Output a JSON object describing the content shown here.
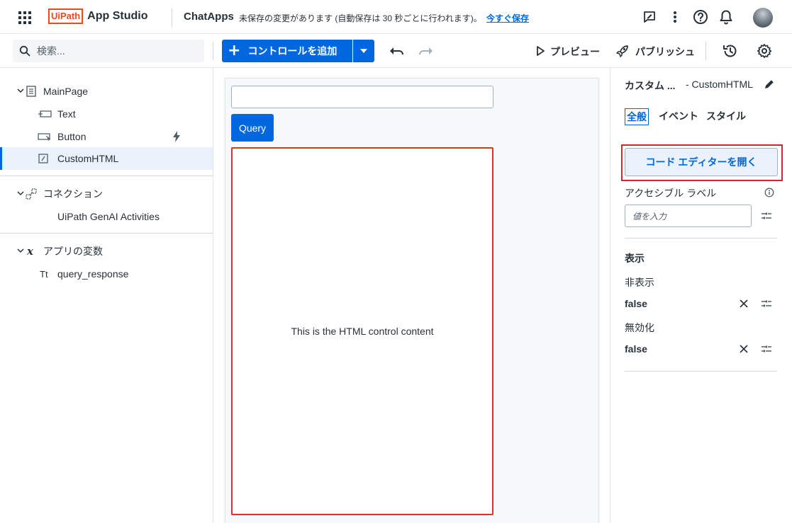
{
  "header": {
    "logo_text": "UiPath",
    "product_name": "App Studio",
    "app_name": "ChatApps",
    "unsaved_message": "未保存の変更があります (自動保存は 30 秒ごとに行われます)。",
    "save_now_label": "今すぐ保存"
  },
  "toolbar": {
    "search_placeholder": "検索...",
    "add_control_label": "コントロールを追加",
    "preview_label": "プレビュー",
    "publish_label": "パブリッシュ"
  },
  "tree": {
    "main_page": "MainPage",
    "controls": [
      "Text",
      "Button",
      "CustomHTML"
    ],
    "connections_label": "コネクション",
    "connection_items": [
      "UiPath GenAI Activities"
    ],
    "variables_label": "アプリの変数",
    "variable_items": [
      "query_response"
    ],
    "variable_type_glyph": "Tt",
    "variables_icon_glyph": "x"
  },
  "canvas": {
    "query_button_label": "Query",
    "custom_html_content": "This is the HTML control content"
  },
  "properties": {
    "title_truncated": "カスタム ...",
    "title_suffix": "- CustomHTML",
    "tabs": [
      "全般",
      "イベント",
      "スタイル"
    ],
    "active_tab": "全般",
    "open_code_editor_label": "コード エディターを開く",
    "accessible_label": "アクセシブル ラベル",
    "accessible_placeholder": "値を入力",
    "display_section": "表示",
    "hidden_label": "非表示",
    "hidden_value": "false",
    "disabled_label": "無効化",
    "disabled_value": "false"
  },
  "colors": {
    "brand_orange": "#fa4616",
    "primary_blue": "#0067df",
    "selection_red": "#d13b1b",
    "highlight_red": "#d9232e"
  }
}
